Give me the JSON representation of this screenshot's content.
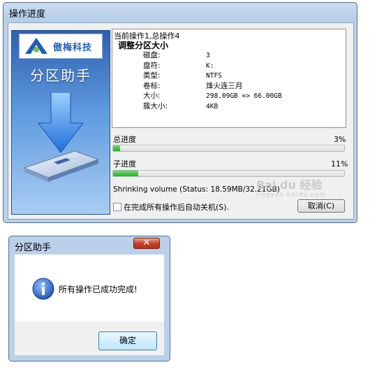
{
  "progress_dialog": {
    "title": "操作进度",
    "brand": {
      "logo_text": "傲梅科技",
      "app_name": "分区助手"
    },
    "operation": {
      "current": "当前操作1,总操作4",
      "name": "调整分区大小",
      "details": [
        {
          "label": "磁盘:",
          "value": "3"
        },
        {
          "label": "盘符:",
          "value": "K:"
        },
        {
          "label": "类型:",
          "value": "NTFS"
        },
        {
          "label": "卷标:",
          "value": "烽火连三月"
        },
        {
          "label": "大小:",
          "value": "298.09GB => 66.00GB"
        },
        {
          "label": "簇大小:",
          "value": "4KB"
        }
      ]
    },
    "total_progress": {
      "label": "总进度",
      "percent_text": "3%",
      "fraction": 0.03
    },
    "sub_progress": {
      "label": "子进度",
      "percent_text": "11%",
      "fraction": 0.11
    },
    "status": "Shrinking volume (Status: 18.59MB/32.21GB)",
    "auto_shutdown": {
      "label": "在完成所有操作后自动关机(S).",
      "checked": false
    },
    "cancel_label": "取消(C)"
  },
  "watermark": {
    "text": "Bai du 经验",
    "small": "jingyan.baidu.com"
  },
  "done_dialog": {
    "title": "分区助手",
    "message": "所有操作已成功完成!",
    "ok_label": "确定"
  },
  "colors": {
    "progress_fill": "#25b021",
    "brand_blue": "#2f5fb0",
    "close_red": "#c4432a"
  }
}
